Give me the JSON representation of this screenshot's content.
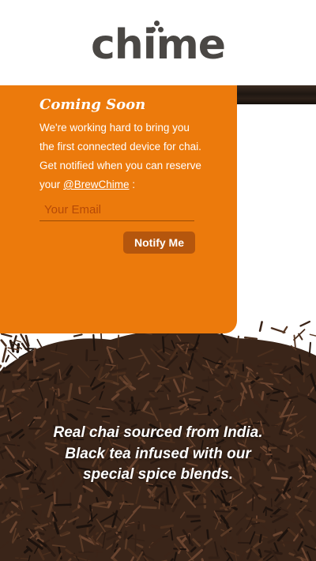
{
  "brand": {
    "logo_text": "chime",
    "logo_color": "#4a4744"
  },
  "signup_card": {
    "title": "Coming Soon",
    "body_text": "We're working hard to bring you the first connected device for chai. Get notified when you can reserve your ",
    "twitter_handle": "@BrewChime",
    "body_suffix": " :",
    "email_placeholder": "Your Email",
    "email_value": "",
    "notify_label": "Notify Me",
    "bg_color": "#ec7a0c",
    "button_color": "#b5560d"
  },
  "hero": {
    "image": "loose-leaf-chai-tea",
    "tagline_lines": [
      "Real chai sourced from India.",
      "Black tea infused with our",
      "special spice blends."
    ]
  }
}
